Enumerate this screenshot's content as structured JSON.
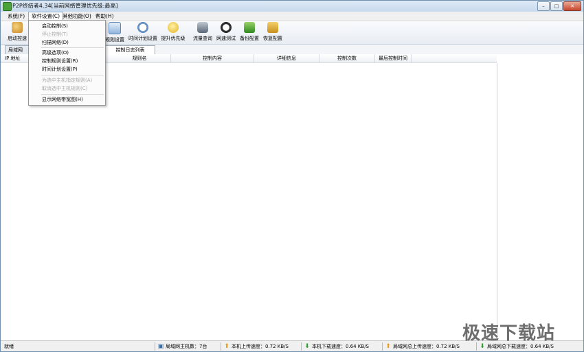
{
  "window": {
    "title": "P2P终结者4.34[当前网络管理优先级:最高]",
    "controls": [
      "minimize",
      "maximize",
      "close"
    ]
  },
  "menubar": {
    "items": [
      "系统(F)",
      "软件设置(C)",
      "其他功能(O)",
      "帮助(H)"
    ]
  },
  "toolbar": {
    "items": [
      {
        "label": "启动控制",
        "icon": "rocket-icon"
      },
      {
        "label": "规则设置",
        "icon": "rules-icon"
      },
      {
        "label": "时间计划设置",
        "icon": "clock-icon"
      },
      {
        "label": "提升优先级",
        "icon": "medal-icon"
      },
      {
        "label": "流量查询",
        "icon": "database-icon"
      },
      {
        "label": "网速测试",
        "icon": "gauge-icon"
      },
      {
        "label": "备份配置",
        "icon": "backup-icon"
      },
      {
        "label": "恢复配置",
        "icon": "restore-icon"
      }
    ],
    "partial_left_label": "启动控速"
  },
  "tabs": {
    "items": [
      "局域网",
      "控制日志列表"
    ]
  },
  "table": {
    "columns": [
      "IP 地址",
      "规则名",
      "控制内容",
      "详细信息",
      "控制次数",
      "最后控制时间"
    ]
  },
  "dropdown": {
    "items": [
      {
        "label": "启动控制(S)",
        "enabled": true
      },
      {
        "label": "停止控制(T)",
        "enabled": false
      },
      {
        "label": "扫描网络(D)",
        "enabled": true
      },
      {
        "sep": true
      },
      {
        "label": "高级选项(O)",
        "enabled": true
      },
      {
        "label": "控制规则设置(R)",
        "enabled": true
      },
      {
        "label": "时间计划设置(P)",
        "enabled": true
      },
      {
        "sep": true
      },
      {
        "label": "为选中主机指定规则(A)",
        "enabled": false
      },
      {
        "label": "取消选中主机规则(C)",
        "enabled": false
      },
      {
        "sep": true
      },
      {
        "label": "显示网络带宽图(H)",
        "enabled": true
      }
    ]
  },
  "statusbar": {
    "status": "就绪",
    "lan_hosts": "局域网主机数：7台",
    "local_up": "本机上传速度：0.72 KB/S",
    "local_down": "本机下载速度：0.64 KB/S",
    "lan_up": "局域网总上传速度：0.72 KB/S",
    "lan_down": "局域网总下载速度：0.64 KB/S"
  },
  "watermark": "极速下载站",
  "colors": {
    "up_arrow": "#e89a1c",
    "down_arrow": "#2f9a2f",
    "title_gradient": "#c8daee"
  }
}
